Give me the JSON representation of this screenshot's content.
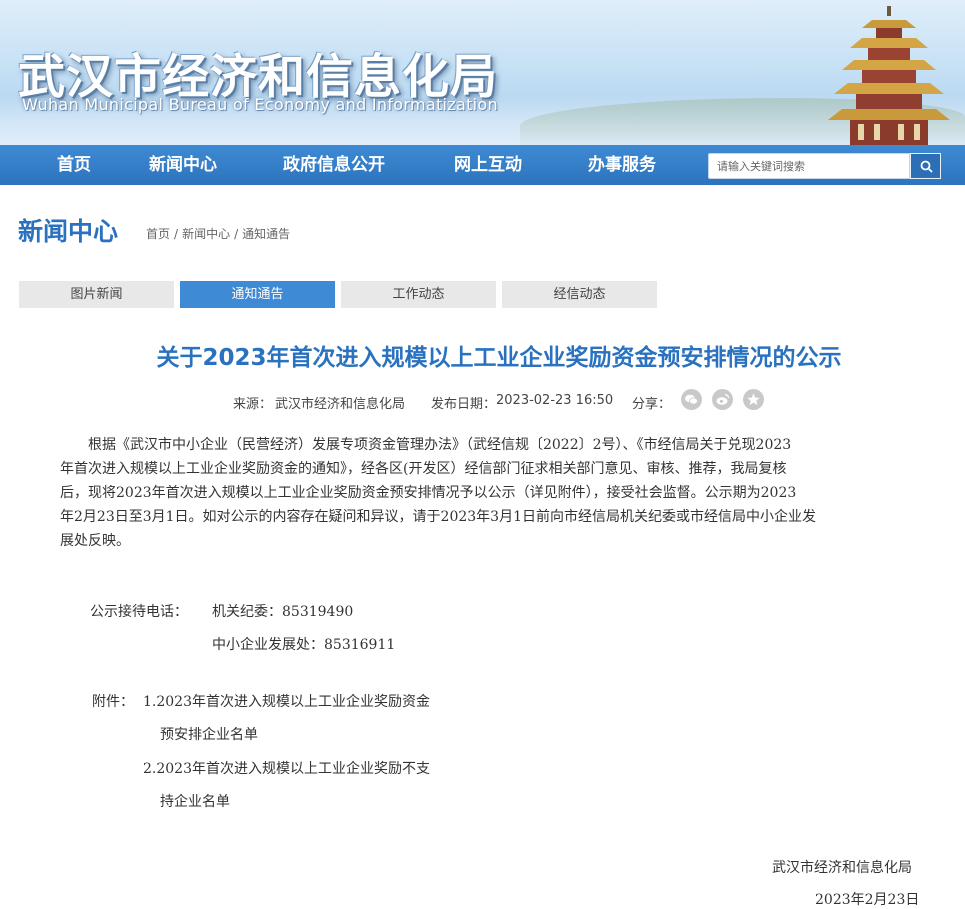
{
  "header": {
    "site_title": "武汉市经济和信息化局",
    "site_subtitle": "Wuhan Municipal Bureau of Economy and Informatization"
  },
  "nav": {
    "items": [
      "首页",
      "新闻中心",
      "政府信息公开",
      "网上互动",
      "办事服务"
    ],
    "search_placeholder": "请输入关键词搜索",
    "search_icon": "search-icon"
  },
  "section": {
    "title": "新闻中心",
    "breadcrumb": [
      "首页",
      "新闻中心",
      "通知通告"
    ],
    "breadcrumb_separator": "/"
  },
  "tabs": [
    {
      "label": "图片新闻",
      "active": false
    },
    {
      "label": "通知通告",
      "active": true
    },
    {
      "label": "工作动态",
      "active": false
    },
    {
      "label": "经信动态",
      "active": false
    }
  ],
  "article": {
    "title": "关于2023年首次进入规模以上工业企业奖励资金预安排情况的公示",
    "source_label": "来源：",
    "source": "武汉市经济和信息化局",
    "date_label": "发布日期：",
    "date": "2023-02-23 16:50",
    "share_label": "分享：",
    "share_icons": [
      "wechat-icon",
      "weibo-icon",
      "favorite-icon"
    ],
    "body_lines": [
      "　　根据《武汉市中小企业（民营经济）发展专项资金管理办法》（武经信规〔2022〕2号）、《市经信局关于兑现2023",
      "年首次进入规模以上工业企业奖励资金的通知》，经各区(开发区）经信部门征求相关部门意见、审核、推荐，我局复核",
      "后，现将2023年首次进入规模以上工业企业奖励资金预安排情况予以公示（详见附件），接受社会监督。公示期为2023",
      "年2月23日至3月1日。如对公示的内容存在疑问和异议，请于2023年3月1日前向市经信局机关纪委或市经信局中小企业发",
      "展处反映。"
    ],
    "contact_label": "公示接待电话：",
    "contact_1": "机关纪委：85319490",
    "contact_2": "中小企业发展处：85316911",
    "attachments_label": "附件：",
    "attachment_1_line1": "1.2023年首次进入规模以上工业企业奖励资金",
    "attachment_1_line2": "预安排企业名单",
    "attachment_2_line1": "2.2023年首次进入规模以上工业企业奖励不支",
    "attachment_2_line2": "持企业名单",
    "signature": "武汉市经济和信息化局",
    "signature_date": "2023年2月23日"
  },
  "colors": {
    "nav_blue": "#2d73bd",
    "accent_blue": "#2a72bf",
    "tab_inactive": "#e8e8e8"
  }
}
